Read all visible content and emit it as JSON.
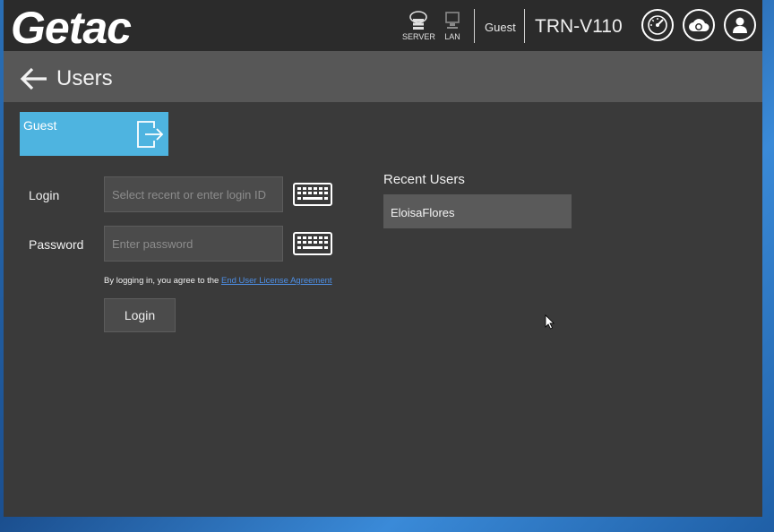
{
  "header": {
    "logo": "Getac",
    "server_label": "SERVER",
    "lan_label": "LAN",
    "user": "Guest",
    "device": "TRN-V110"
  },
  "titlebar": {
    "title": "Users"
  },
  "guest_tile": {
    "label": "Guest"
  },
  "form": {
    "login_label": "Login",
    "login_placeholder": "Select recent or enter login ID",
    "password_label": "Password",
    "password_placeholder": "Enter password",
    "agree_text": "By logging in, you agree to the ",
    "eula_link": "End User License Agreement",
    "login_button": "Login"
  },
  "recent": {
    "title": "Recent Users",
    "items": [
      "EloisaFlores"
    ]
  },
  "icons": {
    "server": "server-icon",
    "lan": "lan-icon",
    "speedometer": "speedometer-icon",
    "cloud": "cloud-sync-icon",
    "user": "user-icon",
    "back": "back-arrow-icon",
    "logout": "logout-icon",
    "keyboard": "keyboard-icon"
  },
  "colors": {
    "accent": "#4eb4e0",
    "link": "#4d8fe6",
    "background": "#3a3a3a"
  }
}
